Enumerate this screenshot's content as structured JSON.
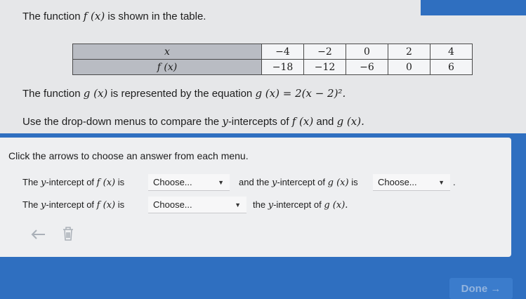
{
  "problem": {
    "line1_a": "The function",
    "line1_fx": "f (x)",
    "line1_b": "is shown in the table.",
    "table": {
      "row1_header": "x",
      "row2_header": "f (x)",
      "x_values": [
        "−4",
        "−2",
        "0",
        "2",
        "4"
      ],
      "fx_values": [
        "−18",
        "−12",
        "−6",
        "0",
        "6"
      ]
    },
    "line2_a": "The function",
    "line2_gx": "g (x)",
    "line2_b": "is represented by the equation",
    "line2_eq": "g (x) = 2(x − 2)².",
    "line3_a": "Use the drop-down menus to compare the",
    "line3_y": "y",
    "line3_b": "-intercepts of",
    "line3_fx": "f (x)",
    "line3_and": "and",
    "line3_gx": "g (x)."
  },
  "answer": {
    "instruction": "Click the arrows to choose an answer from each menu.",
    "row1_a": "The",
    "row1_y": "y",
    "row1_b": "-intercept of",
    "row1_fx": "f (x)",
    "row1_is": "is",
    "row1_dropdown1": "Choose...",
    "row1_c": "and the",
    "row1_y2": "y",
    "row1_d": "-intercept of",
    "row1_gx": "g (x)",
    "row1_is2": "is",
    "row1_dropdown2": "Choose...",
    "row1_period": ".",
    "row2_a": "The",
    "row2_y": "y",
    "row2_b": "-intercept of",
    "row2_fx": "f (x)",
    "row2_is": "is",
    "row2_dropdown": "Choose...",
    "row2_c": "the",
    "row2_y2": "y",
    "row2_d": "-intercept of",
    "row2_gx": "g (x)."
  },
  "footer": {
    "done_label": "Done →"
  },
  "icons": {
    "undo": "undo-arrow-icon",
    "trash": "trash-icon"
  }
}
